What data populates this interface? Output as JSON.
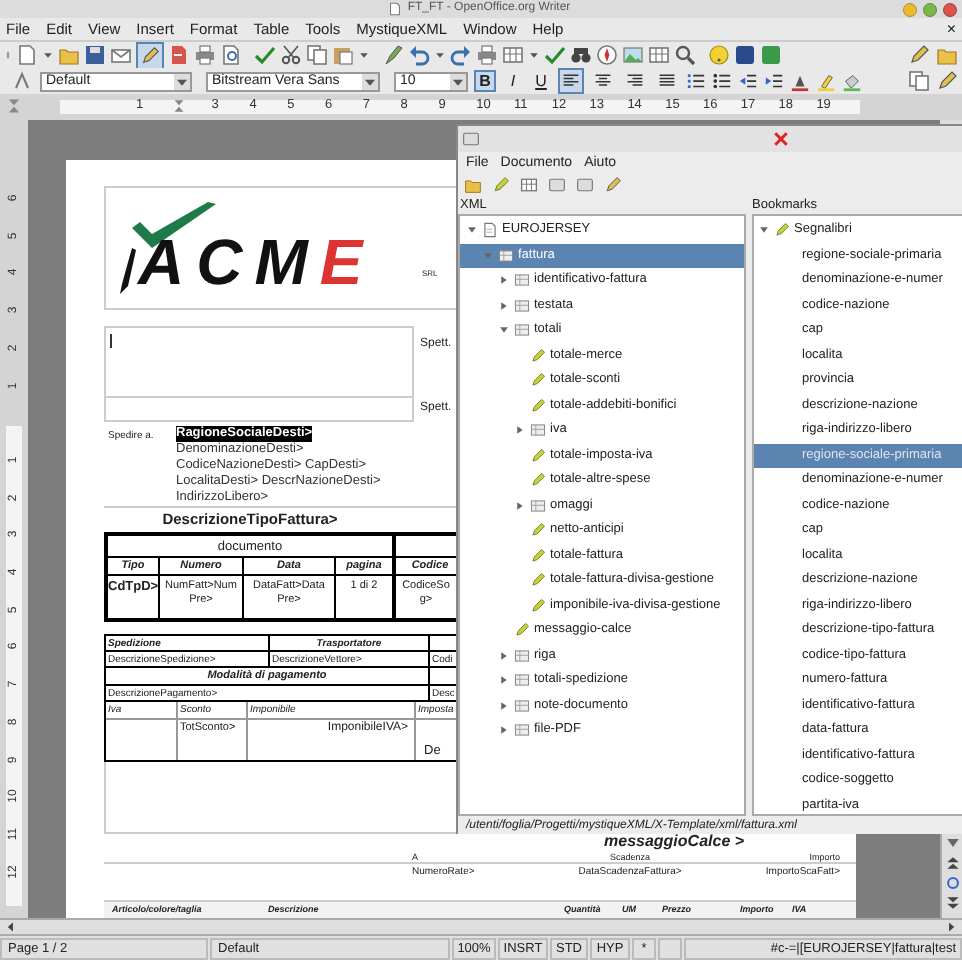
{
  "window": {
    "title": "FT_FT - OpenOffice.org Writer"
  },
  "menu": [
    "File",
    "Edit",
    "View",
    "Insert",
    "Format",
    "Table",
    "Tools",
    "MystiqueXML",
    "Window",
    "Help"
  ],
  "document_close": "×",
  "standard_toolbar": {
    "edit_mode": true
  },
  "formatting": {
    "paragraph_style": "Default",
    "font_name": "Bitstream Vera Sans",
    "font_size": "10",
    "buttons": [
      {
        "label": "B",
        "pressed": true
      },
      {
        "label": "I",
        "pressed": false
      },
      {
        "label": "U",
        "pressed": false
      }
    ],
    "alignment": [
      {
        "kind": "left",
        "selected": true
      },
      {
        "kind": "center",
        "selected": false
      },
      {
        "kind": "right",
        "selected": false
      },
      {
        "kind": "justify",
        "selected": false
      }
    ]
  },
  "ruler": {
    "labels": [
      "1",
      "3",
      "4",
      "5",
      "6",
      "7",
      "8",
      "9",
      "10",
      "11",
      "12",
      "13",
      "14",
      "15",
      "16",
      "17",
      "18",
      "19"
    ]
  },
  "vertical_ruler": {
    "upper_labels": [
      "6",
      "5",
      "4",
      "3",
      "2",
      "1"
    ],
    "lower_labels": [
      "1",
      "2",
      "3",
      "4",
      "5",
      "6",
      "7",
      "8",
      "9",
      "10",
      "11",
      "12"
    ]
  },
  "document": {
    "logo": {
      "text": "ACME",
      "suffix": "SRL"
    },
    "recipient_labels": [
      "Spett.",
      "Spett."
    ],
    "ship_to": {
      "label": "Spedire a.",
      "lines": [
        {
          "text": "RagioneSocialeDesti>",
          "selected": true
        },
        {
          "text": "DenominazioneDesti>",
          "selected": false
        },
        {
          "text": "CodiceNazioneDesti> CapDesti>",
          "selected": false
        },
        {
          "text": "LocalitaDesti> DescrNazioneDesti>",
          "selected": false
        },
        {
          "text": "IndirizzoLibero>",
          "selected": false
        }
      ]
    },
    "invoice_type": "DescrizioneTipoFattura>",
    "doc_table": {
      "title": "documento",
      "columns": [
        "Tipo",
        "Numero",
        "Data",
        "pagina",
        "Codice"
      ],
      "values": [
        "CdTpD>",
        "NumFatt>Num Pre>",
        "DataFatt>Data Pre>",
        "1 di 2",
        "CodiceSo g>"
      ]
    },
    "shipping_table": {
      "columns": [
        "Spedizione",
        "Trasportatore"
      ],
      "values": [
        "DescrizioneSpedizione>",
        "DescrizioneVettore>",
        "Codi"
      ],
      "payment_title": "Modalità di pagamento",
      "payment_values": [
        "DescrizionePagamento>",
        "Desc"
      ],
      "tax_columns": [
        "Iva",
        "Sconto",
        "Imponibile",
        "Imposta"
      ],
      "tax_values": [
        "TotSconto>",
        "ImponibileIVA>",
        "De"
      ]
    },
    "footer_message": "messaggioCalce >",
    "installments": {
      "columns": [
        "A",
        "Scadenza",
        "Importo"
      ],
      "values": [
        "NumeroRate>",
        "DataScadenzaFattura>",
        "ImportoScaFatt>"
      ]
    },
    "lines_header": [
      "Articolo/colore/taglia",
      "Descrizione",
      "Quantità",
      "UM",
      "Prezzo",
      "Importo",
      "IVA"
    ]
  },
  "xml_window": {
    "menu": [
      "File",
      "Documento",
      "Aiuto"
    ],
    "xml_label": "XML",
    "bookmarks_label": "Bookmarks",
    "tree": [
      {
        "label": "EUROJERSEY",
        "kind": "document",
        "expanded": true,
        "selected": false,
        "children": [
          {
            "label": "fattura",
            "kind": "element",
            "expanded": true,
            "selected": true,
            "children": [
              {
                "label": "identificativo-fattura",
                "kind": "element",
                "expanded": false,
                "selected": false
              },
              {
                "label": "testata",
                "kind": "element",
                "expanded": false,
                "selected": false
              },
              {
                "label": "totali",
                "kind": "element",
                "expanded": true,
                "selected": false,
                "children": [
                  {
                    "label": "totale-merce",
                    "kind": "field",
                    "selected": false
                  },
                  {
                    "label": "totale-sconti",
                    "kind": "field",
                    "selected": false
                  },
                  {
                    "label": "totale-addebiti-bonifici",
                    "kind": "field",
                    "selected": false
                  },
                  {
                    "label": "iva",
                    "kind": "element",
                    "expanded": false,
                    "selected": false
                  },
                  {
                    "label": "totale-imposta-iva",
                    "kind": "field",
                    "selected": false
                  },
                  {
                    "label": "totale-altre-spese",
                    "kind": "field",
                    "selected": false
                  },
                  {
                    "label": "omaggi",
                    "kind": "element",
                    "expanded": false,
                    "selected": false
                  },
                  {
                    "label": "netto-anticipi",
                    "kind": "field",
                    "selected": false
                  },
                  {
                    "label": "totale-fattura",
                    "kind": "field",
                    "selected": false
                  },
                  {
                    "label": "totale-fattura-divisa-gestione",
                    "kind": "field",
                    "selected": false
                  },
                  {
                    "label": "imponibile-iva-divisa-gestione",
                    "kind": "field",
                    "selected": false
                  }
                ]
              },
              {
                "label": "messaggio-calce",
                "kind": "field",
                "selected": false
              },
              {
                "label": "riga",
                "kind": "element",
                "expanded": false,
                "selected": false
              },
              {
                "label": "totali-spedizione",
                "kind": "element",
                "expanded": false,
                "selected": false
              },
              {
                "label": "note-documento",
                "kind": "element",
                "expanded": false,
                "selected": false
              },
              {
                "label": "file-PDF",
                "kind": "element",
                "expanded": false,
                "selected": false
              }
            ]
          }
        ]
      }
    ],
    "bookmarks": {
      "label": "Segnalibri",
      "expanded": true,
      "items": [
        {
          "label": "regione-sociale-primaria",
          "selected": false
        },
        {
          "label": "denominazione-e-numer",
          "selected": false
        },
        {
          "label": "codice-nazione",
          "selected": false
        },
        {
          "label": "cap",
          "selected": false
        },
        {
          "label": "localita",
          "selected": false
        },
        {
          "label": "provincia",
          "selected": false
        },
        {
          "label": "descrizione-nazione",
          "selected": false
        },
        {
          "label": "riga-indirizzo-libero",
          "selected": false
        },
        {
          "label": "regione-sociale-primaria",
          "selected": true
        },
        {
          "label": "denominazione-e-numer",
          "selected": false
        },
        {
          "label": "codice-nazione",
          "selected": false
        },
        {
          "label": "cap",
          "selected": false
        },
        {
          "label": "localita",
          "selected": false
        },
        {
          "label": "descrizione-nazione",
          "selected": false
        },
        {
          "label": "riga-indirizzo-libero",
          "selected": false
        },
        {
          "label": "descrizione-tipo-fattura",
          "selected": false
        },
        {
          "label": "codice-tipo-fattura",
          "selected": false
        },
        {
          "label": "numero-fattura",
          "selected": false
        },
        {
          "label": "identificativo-fattura",
          "selected": false
        },
        {
          "label": "data-fattura",
          "selected": false
        },
        {
          "label": "identificativo-fattura",
          "selected": false
        },
        {
          "label": "codice-soggetto",
          "selected": false
        },
        {
          "label": "partita-iva",
          "selected": false
        }
      ]
    },
    "path": "/utenti/foglia/Progetti/mystiqueXML/X-Template/xml/fattura.xml"
  },
  "status_bar": [
    "Page 1 / 2",
    "Default",
    "100%",
    "INSRT",
    "STD",
    "HYP",
    "*",
    "#c-=|[EUROJERSEY|fattura|test"
  ]
}
